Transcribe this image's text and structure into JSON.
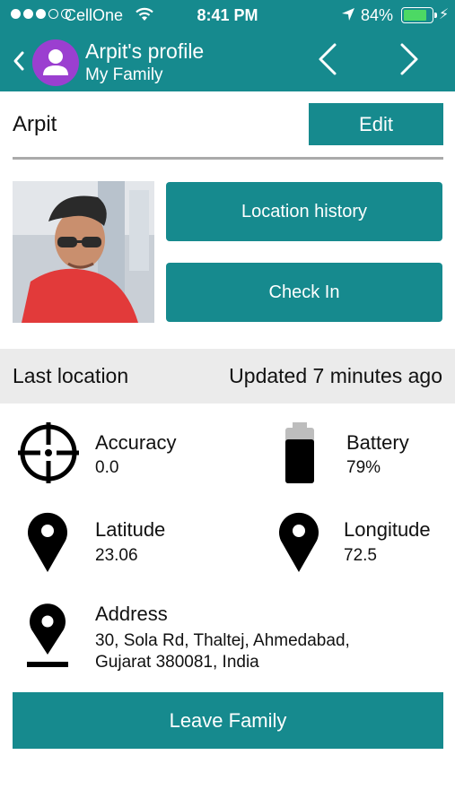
{
  "status_bar": {
    "carrier": "CellOne",
    "time": "8:41 PM",
    "battery_percent": "84%",
    "battery_level": 0.84,
    "signal_bars": 3,
    "signal_total": 5
  },
  "header": {
    "title": "Arpit's profile",
    "subtitle": "My Family"
  },
  "profile": {
    "name": "Arpit",
    "edit_label": "Edit"
  },
  "actions": {
    "location_history_label": "Location history",
    "check_in_label": "Check In"
  },
  "last_location": {
    "label": "Last location",
    "updated": "Updated 7 minutes ago"
  },
  "details": {
    "accuracy_label": "Accuracy",
    "accuracy_value": "0.0",
    "battery_label": "Battery",
    "battery_value": "79%",
    "latitude_label": "Latitude",
    "latitude_value": "23.06",
    "longitude_label": "Longitude",
    "longitude_value": "72.5",
    "address_label": "Address",
    "address_line1": "30, Sola Rd, Thaltej, Ahmedabad,",
    "address_line2": "Gujarat 380081, India"
  },
  "footer": {
    "leave_label": "Leave Family"
  },
  "colors": {
    "primary": "#168a8e",
    "avatar": "#9b3fd0",
    "battery_green": "#4cd964",
    "section_bg": "#ebebeb"
  },
  "icons": [
    "back-chevron-icon",
    "user-avatar-icon",
    "prev-chevron-icon",
    "next-chevron-icon",
    "crosshair-icon",
    "battery-icon",
    "map-pin-icon"
  ]
}
